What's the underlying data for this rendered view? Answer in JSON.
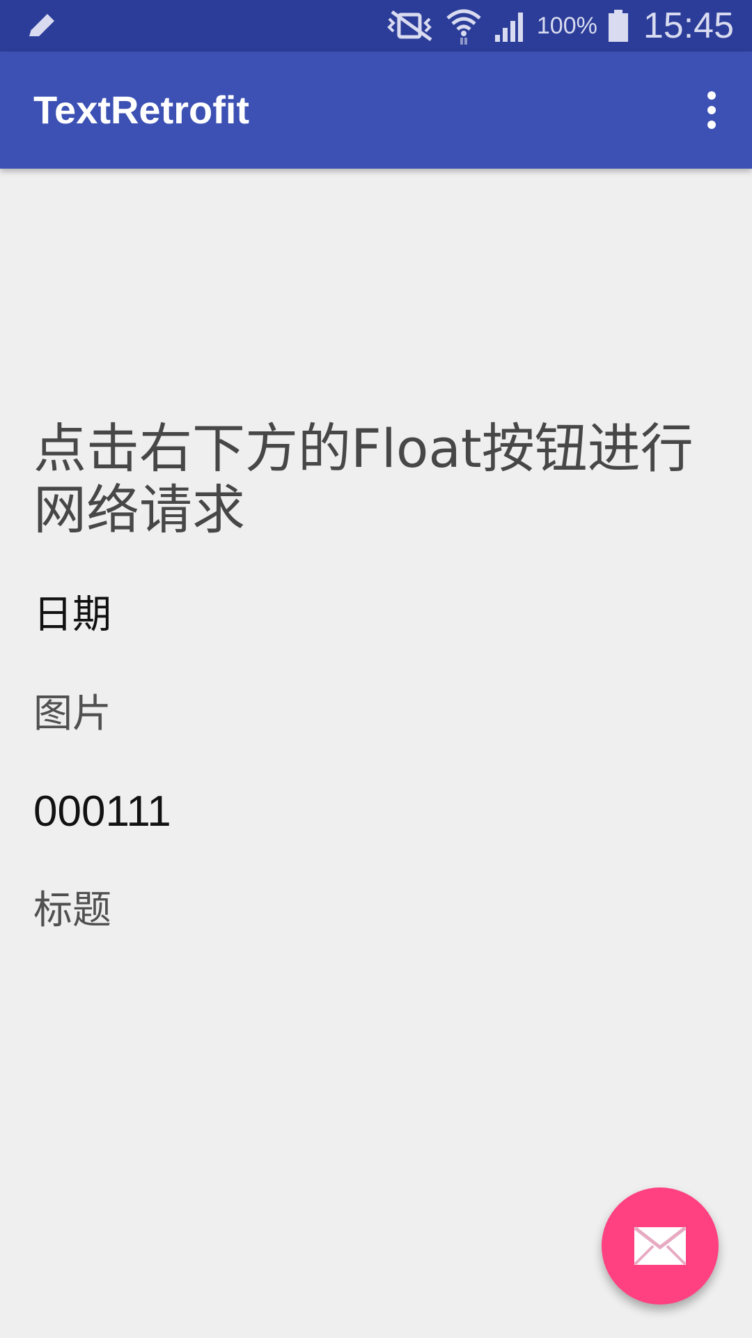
{
  "status_bar": {
    "battery_percent": "100%",
    "time": "15:45",
    "icons": [
      "edit-pencil-icon",
      "vibrate-mute-icon",
      "wifi-icon",
      "signal-icon",
      "battery-icon"
    ]
  },
  "app_bar": {
    "title": "TextRetrofit",
    "menu_icon": "overflow-menu-icon"
  },
  "main": {
    "instruction": "点击右下方的Float按钮进行网络请求",
    "date_label": "日期",
    "image_label": "图片",
    "code_value": "000111",
    "title_label": "标题"
  },
  "fab": {
    "icon": "mail-icon"
  },
  "colors": {
    "status_bar": "#2c3d99",
    "app_bar": "#3c51b3",
    "background": "#efefef",
    "fab": "#ff4081"
  }
}
